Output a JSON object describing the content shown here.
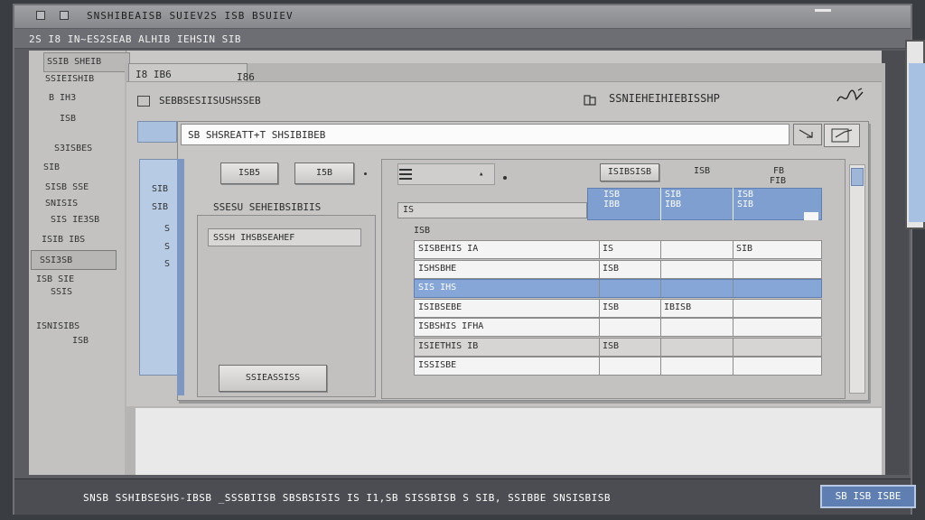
{
  "window": {
    "title": "SNSHIBEAISB SUIEV2S ISB BSUIEV",
    "menu_text": "2S I8 IN~ES2SEAB ALHIB IEHSIN SIB"
  },
  "left_pane": {
    "tab_label": "SSIB SHEIB",
    "items": [
      "SSIEISHIB",
      "B IH3",
      "ISB",
      "S3ISBES",
      "SIB",
      "SISB SSE",
      "SNISIS",
      "SIS IE3SB",
      "ISIB IBS",
      "SSI3SB",
      "ISB SIE",
      "SSIS",
      "ISNISIBS",
      "ISB"
    ]
  },
  "main_panel": {
    "tab_label": "I8 IB6",
    "tab2_label": "I86",
    "subtitle": "SEBBSESIISUSHSSEB",
    "right_header": "SSNIEHEIHIEBISSHP"
  },
  "dialog": {
    "address_text": "SB  SHSREATT+T SHSIBIBEB",
    "button_a": "ISB5",
    "button_b": "I5B",
    "left_header": "SSESU  SEHEIBSIBIIS",
    "left_field": "SSSH  IHSBSEAHEF",
    "left_button": "SSIEASSISS",
    "left_blue_items": [
      "SIB",
      "SIB",
      "S",
      "S",
      "S"
    ],
    "filter_text": "IS",
    "list_label": "ISB",
    "header_buttons": {
      "col1": "ISIBSISB",
      "col2": "ISB",
      "col3": "FB",
      "col3b": "FIB"
    },
    "grid_headers": [
      [
        "ISB",
        "IBB"
      ],
      [
        "SIB",
        "IBB"
      ],
      [
        "ISB",
        "SIB"
      ]
    ],
    "rows": [
      {
        "name": "SISBEHIS IA",
        "c2": "IS",
        "c3": "",
        "c4": "SIB",
        "style": "normal"
      },
      {
        "name": "ISHSBHE",
        "c2": "ISB",
        "c3": "",
        "c4": "",
        "style": "normal"
      },
      {
        "name": "SIS IHS",
        "c2": "",
        "c3": "",
        "c4": "",
        "style": "selected"
      },
      {
        "name": "ISIBSEBE",
        "c2": "ISB",
        "c3": "IBISB",
        "c4": "",
        "style": "normal"
      },
      {
        "name": "ISBSHIS IFHA",
        "c2": "",
        "c3": "",
        "c4": "",
        "style": "normal"
      },
      {
        "name": "ISIETHIS IB",
        "c2": "ISB",
        "c3": "",
        "c4": "",
        "style": "grey"
      },
      {
        "name": "ISSISBE",
        "c2": "",
        "c3": "",
        "c4": "",
        "style": "normal"
      }
    ]
  },
  "status_bar": {
    "text": "SNSB SSHIBSESHS-IBSB  _SSSBIISB SBSBSISIS IS I1,SB  SISSBISB S SIB, SSIBBE SNSISBISB",
    "badge": "SB ISB ISBE"
  },
  "colors": {
    "accent_blue": "#85a6d6",
    "header_blue": "#7f9fd0",
    "panel_grey": "#c7c6c4",
    "status_bar": "#4b4d52"
  },
  "icons": {
    "folder": "folder-icon",
    "signature": "signature-icon",
    "list": "list-icon"
  }
}
